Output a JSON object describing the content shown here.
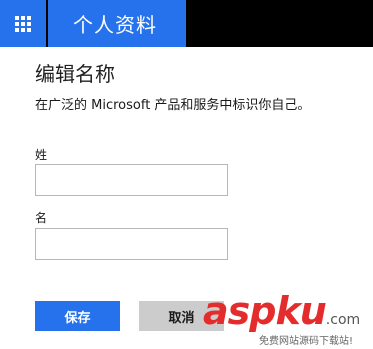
{
  "header": {
    "app_launcher_icon": "waffle-grid-icon",
    "title": "个人资料",
    "accent_color": "#2672ec"
  },
  "form": {
    "heading": "编辑名称",
    "description": "在广泛的 Microsoft 产品和服务中标识你自己。",
    "last_name_label": "姓",
    "last_name_value": "",
    "first_name_label": "名",
    "first_name_value": ""
  },
  "actions": {
    "save_label": "保存",
    "cancel_label": "取消"
  },
  "watermark": {
    "logo_asp": "asp",
    "logo_ku": "ku",
    "logo_suffix": ".com",
    "caption": "免费网站源码下载站!"
  }
}
